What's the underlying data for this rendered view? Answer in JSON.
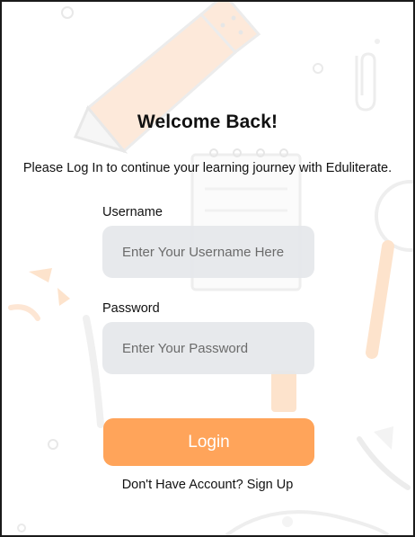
{
  "page": {
    "title": "Welcome Back!",
    "subtitle": "Please Log In to continue your learning journey with Eduliterate."
  },
  "form": {
    "username_label": "Username",
    "username_placeholder": "Enter Your Username Here",
    "username_value": "",
    "password_label": "Password",
    "password_placeholder": "Enter Your Password",
    "password_value": "",
    "login_label": "Login"
  },
  "footer": {
    "signup_prompt": "Don't Have Account?",
    "signup_link": "Sign Up"
  },
  "colors": {
    "accent": "#ffa45a",
    "input_bg": "#e5e7ea",
    "decor_orange": "#fde7d6",
    "decor_gray": "#f1f1f1"
  },
  "icons": [
    "pencil-icon",
    "paperclip-icon",
    "notepad-icon",
    "brush-icon",
    "magnifier-icon",
    "palette-icon"
  ]
}
